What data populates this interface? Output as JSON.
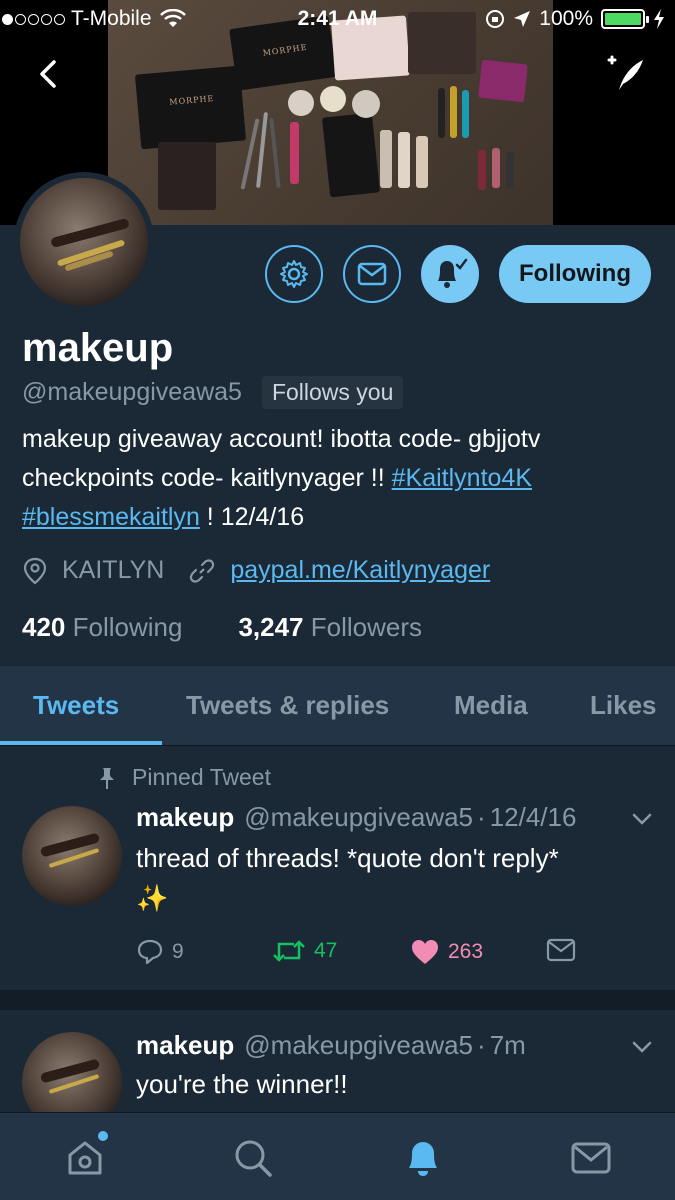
{
  "status_bar": {
    "carrier": "T-Mobile",
    "time": "2:41 AM",
    "battery": "100%"
  },
  "banner": {
    "palette_brand_1": "MORPHE",
    "palette_brand_2": "MORPHE"
  },
  "profile": {
    "name": "makeup",
    "handle": "@makeupgiveawa5",
    "follows_you": "Follows you",
    "following_button": "Following",
    "bio_line1": "makeup giveaway account! ibotta code- gbjjotv",
    "bio_line2_text": "checkpoints code- kaitlynyager !! ",
    "bio_hashtag1": "#Kaitlynto4K",
    "bio_hashtag2": "#blessmekaitlyn",
    "bio_tail": " ! 12/4/16",
    "location": "KAITLYN",
    "url": "paypal.me/Kaitlynyager",
    "following_count": "420",
    "following_label": "Following",
    "followers_count": "3,247",
    "followers_label": "Followers"
  },
  "tabs": [
    {
      "label": "Tweets",
      "active": true
    },
    {
      "label": "Tweets & replies",
      "active": false
    },
    {
      "label": "Media",
      "active": false
    },
    {
      "label": "Likes",
      "active": false
    }
  ],
  "tweets": [
    {
      "pinned_label": "Pinned Tweet",
      "name": "makeup",
      "handle": "@makeupgiveawa5",
      "time": "12/4/16",
      "text": "thread of threads! *quote don't reply*",
      "emoji": "✨",
      "replies": "9",
      "retweets": "47",
      "likes": "263"
    },
    {
      "name": "makeup",
      "handle": "@makeupgiveawa5",
      "time": "7m",
      "text": "you're the winner!!"
    }
  ],
  "colors": {
    "background": "#1b2836",
    "accent": "#5ab9f0",
    "retweet_green": "#17bf63",
    "like_pink": "#e0245e"
  },
  "icons": [
    "back-arrow-icon",
    "compose-tweet-icon",
    "gear-icon",
    "mail-icon",
    "bell-check-icon",
    "location-pin-icon",
    "link-icon",
    "pin-icon",
    "chevron-down-icon",
    "reply-icon",
    "retweet-icon",
    "heart-icon",
    "direct-message-icon",
    "home-icon",
    "search-icon",
    "notifications-icon",
    "messages-icon"
  ]
}
